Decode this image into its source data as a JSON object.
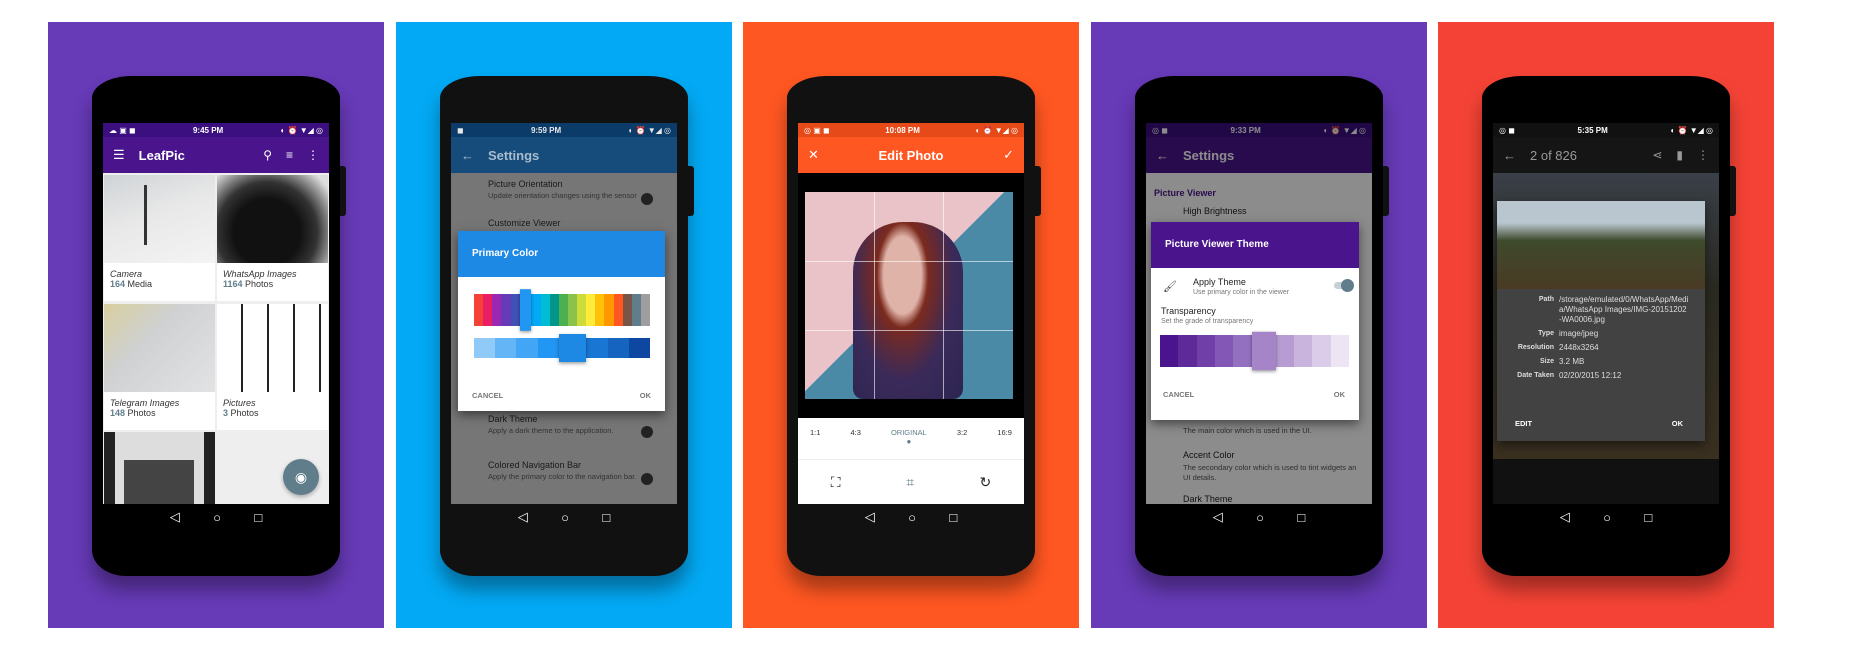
{
  "colors": {
    "panel1": "#673AB7",
    "panel2": "#03A9F4",
    "panel3": "#FF5722",
    "panel4": "#673AB7",
    "panel5": "#F44336"
  },
  "nav_icons": [
    "back-icon",
    "home-icon",
    "recents-icon"
  ],
  "nav_glyphs": [
    "◁",
    "○",
    "□"
  ],
  "screen1": {
    "time": "9:45 PM",
    "title": "LeafPic",
    "icons": [
      "menu-icon",
      "search-icon",
      "sort-icon",
      "more-icon"
    ],
    "albums": [
      {
        "name": "Camera",
        "count": "164",
        "unit": "Media"
      },
      {
        "name": "WhatsApp Images",
        "count": "1164",
        "unit": "Photos"
      },
      {
        "name": "Telegram Images",
        "count": "148",
        "unit": "Photos"
      },
      {
        "name": "Pictures",
        "count": "3",
        "unit": "Photos"
      }
    ],
    "fab_icon": "camera-icon"
  },
  "screen2": {
    "time": "9:59 PM",
    "title": "Settings",
    "items": [
      {
        "title": "Picture Orientation",
        "sub": "Update orientation changes using the sensor"
      },
      {
        "title": "Customize Viewer",
        "sub": ""
      },
      {
        "title": "Dark Theme",
        "sub": "Apply a dark theme to the application."
      },
      {
        "title": "Colored Navigation Bar",
        "sub": "Apply the primary color to the navigation bar."
      }
    ],
    "dialog": {
      "title": "Primary Color",
      "cancel": "CANCEL",
      "ok": "OK",
      "palette": [
        "#F44336",
        "#E91E63",
        "#9C27B0",
        "#673AB7",
        "#3F51B5",
        "#2196F3",
        "#03A9F4",
        "#00BCD4",
        "#009688",
        "#4CAF50",
        "#8BC34A",
        "#CDDC39",
        "#FFEB3B",
        "#FFC107",
        "#FF9800",
        "#FF5722",
        "#795548",
        "#607D8B",
        "#9E9E9E"
      ],
      "selected_primary": "#2196F3",
      "shades": [
        "#90CAF9",
        "#64B5F6",
        "#42A5F5",
        "#2196F3",
        "#1E88E5",
        "#1976D2",
        "#1565C0",
        "#0D47A1"
      ],
      "selected_shade": "#1E88E5"
    }
  },
  "screen3": {
    "time": "10:08 PM",
    "title": "Edit Photo",
    "close_icon": "close-icon",
    "confirm_icon": "check-icon",
    "ratios": [
      "1:1",
      "4:3",
      "ORIGINAL",
      "3:2",
      "16:9"
    ],
    "selected_ratio": "ORIGINAL",
    "tools": [
      "fit-icon",
      "crop-icon",
      "rotate-icon"
    ]
  },
  "screen4": {
    "time": "9:33 PM",
    "title": "Settings",
    "section": "Picture Viewer",
    "bg_item": "High Brightness",
    "below": [
      {
        "title": "",
        "sub": "The main color which is used in the UI."
      },
      {
        "title": "Accent Color",
        "sub": "The secondary color which is used to tint widgets an UI details."
      },
      {
        "title": "Dark Theme",
        "sub": ""
      }
    ],
    "dialog": {
      "title": "Picture Viewer Theme",
      "apply_title": "Apply Theme",
      "apply_sub": "Use primary color in the viewer",
      "apply_on": true,
      "trans_title": "Transparency",
      "trans_sub": "Set the grade of transparency",
      "shades": [
        "#4A148C",
        "#5E2A9A",
        "#7040A8",
        "#8257B5",
        "#9470C0",
        "#A584C8",
        "#B79CD3",
        "#C9B4DE",
        "#DBCDE9",
        "#EDE5F4"
      ],
      "selected_index": 5,
      "cancel": "CANCEL",
      "ok": "OK"
    }
  },
  "screen5": {
    "time": "5:35 PM",
    "title": "2 of 826",
    "icons": [
      "back-icon",
      "share-icon",
      "delete-icon",
      "more-icon"
    ],
    "details": [
      {
        "label": "Path",
        "value": "/storage/emulated/0/WhatsApp/Media/WhatsApp Images/IMG-20151202-WA0006.jpg"
      },
      {
        "label": "Type",
        "value": "image/jpeg"
      },
      {
        "label": "Resolution",
        "value": "2448x3264"
      },
      {
        "label": "Size",
        "value": "3.2 MB"
      },
      {
        "label": "Date Taken",
        "value": "02/20/2015 12:12"
      }
    ],
    "edit": "EDIT",
    "ok": "OK"
  }
}
